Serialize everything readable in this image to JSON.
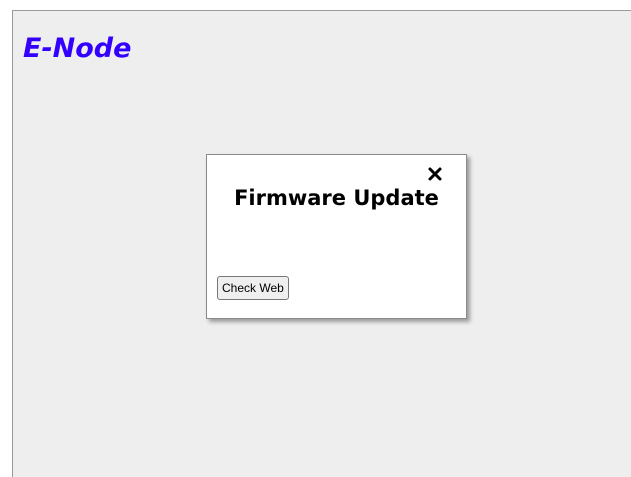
{
  "app": {
    "brand": "E-Node"
  },
  "dialog": {
    "title": "Firmware Update",
    "close_icon": "close-icon",
    "check_web_label": "Check Web"
  },
  "colors": {
    "brand": "#3300ff",
    "page_background": "#eeeeee",
    "dialog_background": "#ffffff"
  }
}
